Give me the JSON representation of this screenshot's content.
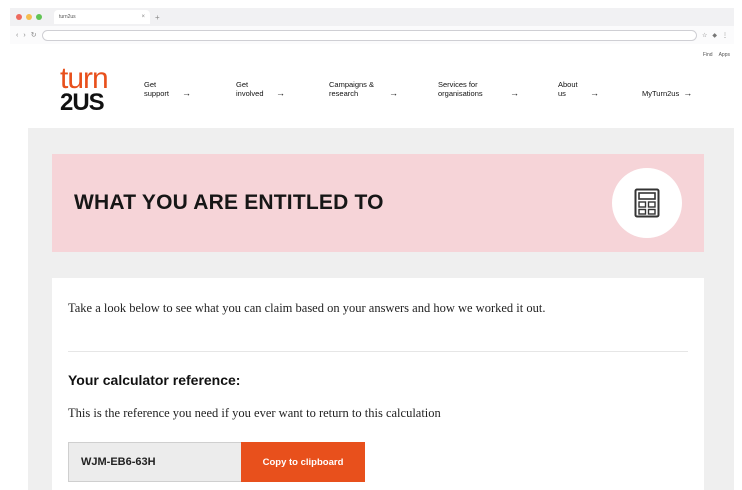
{
  "browser": {
    "tab_title": "turn2us",
    "url": ""
  },
  "header": {
    "utility_links": [
      "Find",
      "Apps"
    ],
    "logo": {
      "line1": "turn",
      "line2": "2US"
    },
    "nav": [
      {
        "label": "Get support"
      },
      {
        "label": "Get involved"
      },
      {
        "label": "Campaigns & research"
      },
      {
        "label": "Services for organisations"
      },
      {
        "label": "About us"
      },
      {
        "label": "MyTurn2us"
      }
    ]
  },
  "banner": {
    "title": "WHAT YOU ARE ENTITLED TO",
    "icon": "calculator-icon"
  },
  "card": {
    "intro": "Take a look below to see what you can claim based on your answers and how we worked it out.",
    "reference_heading": "Your calculator reference:",
    "reference_description": "This is the reference you need if you ever want to return to this calculation",
    "reference_code": "WJM-EB6-63H",
    "copy_button_label": "Copy to clipboard"
  },
  "colors": {
    "brand_orange": "#e8501c",
    "banner_pink": "#f6d4d8",
    "page_grey": "#efefef"
  }
}
